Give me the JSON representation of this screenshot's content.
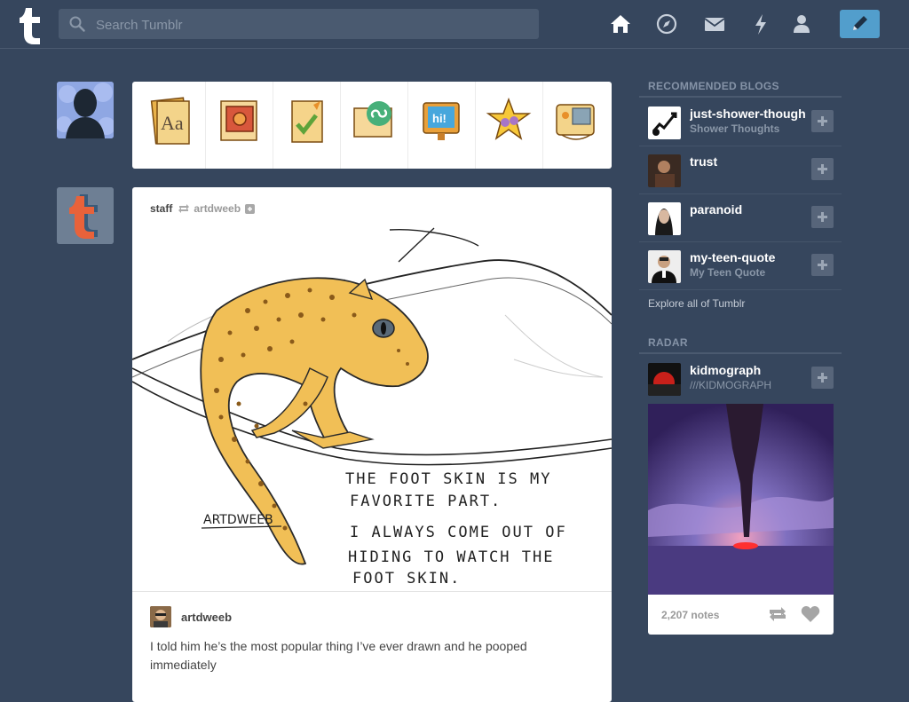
{
  "header": {
    "search_placeholder": "Search Tumblr",
    "nav_icons": [
      "home-icon",
      "explore-icon",
      "inbox-icon",
      "activity-icon",
      "account-icon"
    ],
    "compose_icon": "pencil-icon",
    "accent_color": "#529ecc"
  },
  "post_types": [
    "text-icon",
    "photo-icon",
    "quote-icon",
    "link-icon",
    "chat-icon",
    "audio-icon",
    "video-icon"
  ],
  "post": {
    "reblogger": "staff",
    "source": "artdweeb",
    "illustration": {
      "signature": "ARTDWEEB",
      "line1": "THE FOOT SKIN IS MY",
      "line2": "FAVORITE PART.",
      "line3": "I ALWAYS COME OUT OF",
      "line4": "HIDING TO WATCH THE",
      "line5": "FOOT SKIN."
    },
    "caption_user": "artdweeb",
    "caption": "I told him he’s the most popular thing I’ve ever drawn and he pooped immediately"
  },
  "sidebar": {
    "recommended_title": "RECOMMENDED BLOGS",
    "blogs": [
      {
        "name": "just-shower-thoughts",
        "title": "Shower Thoughts"
      },
      {
        "name": "trust",
        "title": ""
      },
      {
        "name": "paranoid",
        "title": ""
      },
      {
        "name": "my-teen-quote",
        "title": "My Teen Quote"
      }
    ],
    "explore_link": "Explore all of Tumblr",
    "radar_title": "RADAR",
    "radar": {
      "name": "kidmograph",
      "title": "///KIDMOGRAPH",
      "notes": "2,207 notes"
    }
  }
}
